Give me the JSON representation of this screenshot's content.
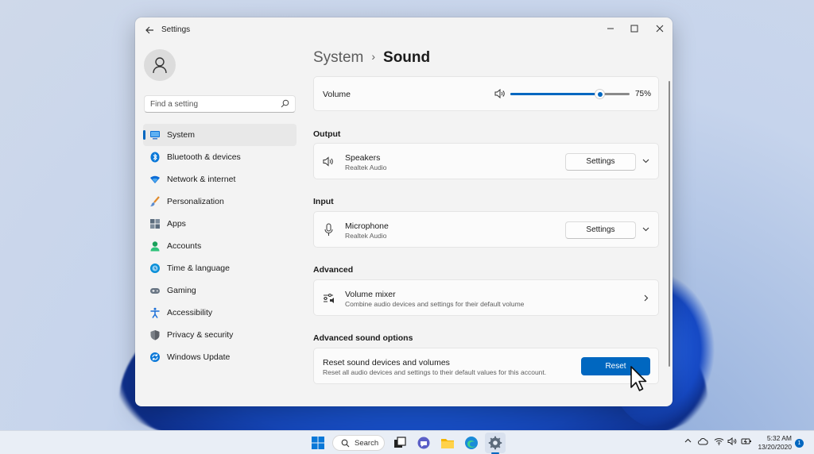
{
  "window": {
    "title": "Settings"
  },
  "search": {
    "placeholder": "Find a setting"
  },
  "nav": [
    {
      "label": "System",
      "icon": "system-icon",
      "color": "#0078d4",
      "active": true
    },
    {
      "label": "Bluetooth & devices",
      "icon": "bluetooth-icon",
      "color": "#0078d4"
    },
    {
      "label": "Network & internet",
      "icon": "wifi-icon",
      "color": "#0b6bd6"
    },
    {
      "label": "Personalization",
      "icon": "brush-icon",
      "color": "#e08a2c"
    },
    {
      "label": "Apps",
      "icon": "apps-icon",
      "color": "#4a5a6a"
    },
    {
      "label": "Accounts",
      "icon": "account-icon",
      "color": "#19a05a"
    },
    {
      "label": "Time & language",
      "icon": "globe-clock-icon",
      "color": "#0a8fd8"
    },
    {
      "label": "Gaming",
      "icon": "gamepad-icon",
      "color": "#6b7785"
    },
    {
      "label": "Accessibility",
      "icon": "accessibility-icon",
      "color": "#1a6fd8"
    },
    {
      "label": "Privacy & security",
      "icon": "shield-icon",
      "color": "#6b6f75"
    },
    {
      "label": "Windows Update",
      "icon": "update-icon",
      "color": "#0a78d8"
    }
  ],
  "breadcrumb": {
    "parent": "System",
    "separator": "›",
    "current": "Sound"
  },
  "volume": {
    "label": "Volume",
    "value": "75%",
    "level": 0.75
  },
  "output": {
    "header": "Output",
    "device": "Speakers",
    "sub": "Realtek Audio",
    "button": "Settings"
  },
  "input": {
    "header": "Input",
    "device": "Microphone",
    "sub": "Realtek Audio",
    "button": "Settings"
  },
  "advanced": {
    "header": "Advanced",
    "mixer_title": "Volume mixer",
    "mixer_sub": "Combine audio devices and settings for their default volume"
  },
  "advanced_sound": {
    "header": "Advanced sound options",
    "title": "Reset sound devices and volumes",
    "sub": "Reset all audio devices and settings to their default values for this account.",
    "button": "Reset"
  },
  "taskbar": {
    "search_label": "Search",
    "time": "5:32 AM",
    "date": "13/20/2020",
    "notification_count": "1"
  },
  "colors": {
    "accent": "#0067c0"
  }
}
